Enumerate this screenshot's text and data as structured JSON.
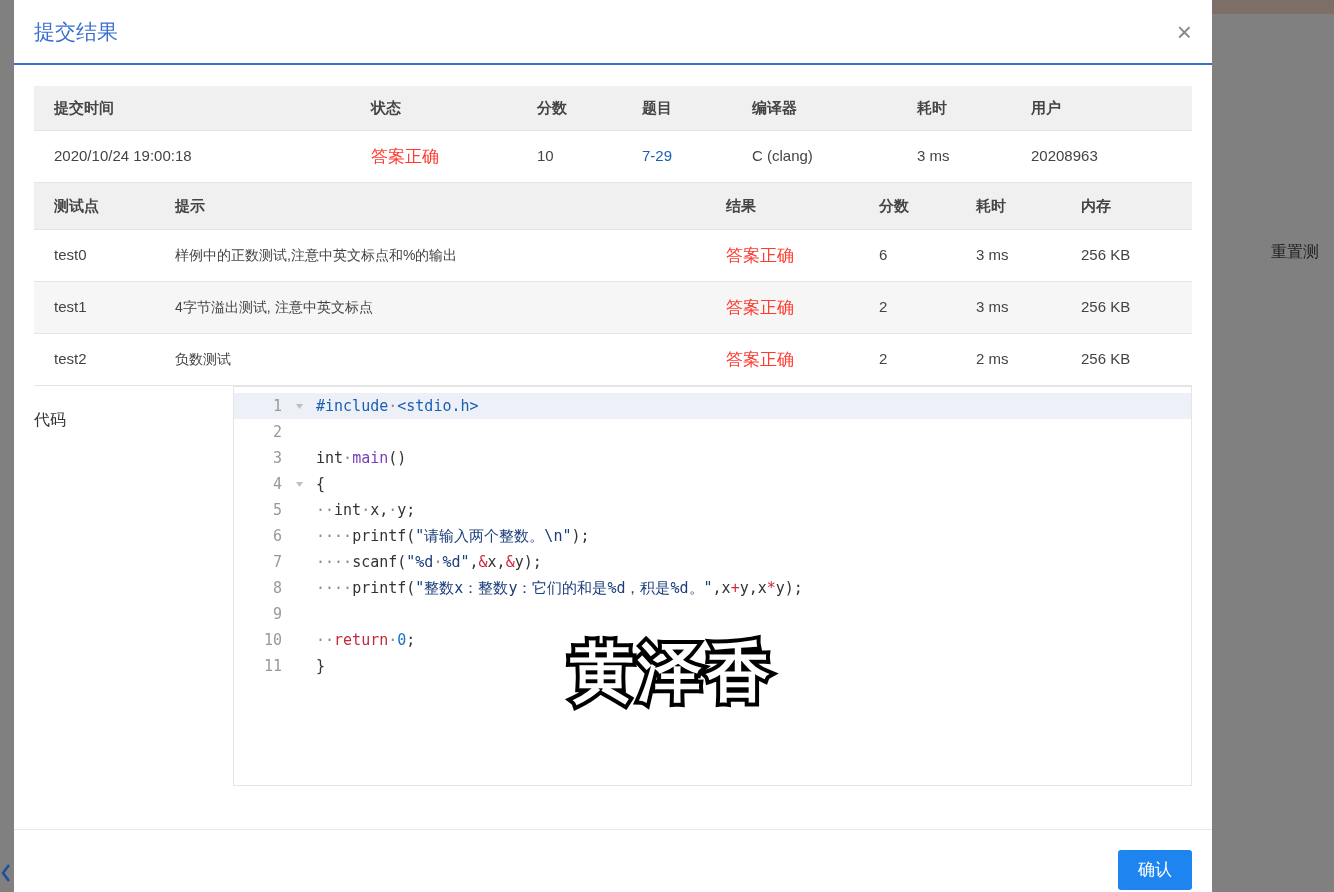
{
  "background": {
    "right_text": "重置测"
  },
  "dialog": {
    "title": "提交结果",
    "close": "×"
  },
  "summary": {
    "columns": [
      "提交时间",
      "状态",
      "分数",
      "题目",
      "编译器",
      "耗时",
      "用户"
    ],
    "row": {
      "time": "2020/10/24 19:00:18",
      "status": "答案正确",
      "score": "10",
      "problem": "7-29",
      "compiler": "C (clang)",
      "duration": "3 ms",
      "user": "20208963"
    }
  },
  "tests": {
    "columns": [
      "测试点",
      "提示",
      "结果",
      "分数",
      "耗时",
      "内存"
    ],
    "rows": [
      {
        "name": "test0",
        "hint": "样例中的正数测试,注意中英文标点和%的输出",
        "result": "答案正确",
        "score": "6",
        "duration": "3 ms",
        "memory": "256 KB"
      },
      {
        "name": "test1",
        "hint": "4字节溢出测试, 注意中英文标点",
        "result": "答案正确",
        "score": "2",
        "duration": "3 ms",
        "memory": "256 KB"
      },
      {
        "name": "test2",
        "hint": "负数测试",
        "result": "答案正确",
        "score": "2",
        "duration": "2 ms",
        "memory": "256 KB"
      }
    ]
  },
  "code": {
    "label": "代码",
    "lines": [
      {
        "number": "1",
        "fold": true,
        "active": true,
        "tokens": [
          {
            "kind": "pre",
            "text": "#include"
          },
          {
            "kind": "ws",
            "text": "·"
          },
          {
            "kind": "pre",
            "text": "<stdio.h>"
          }
        ]
      },
      {
        "number": "2",
        "fold": false,
        "active": false
      },
      {
        "number": "3",
        "fold": false,
        "active": false,
        "tokens": [
          {
            "kind": "plain",
            "text": "int"
          },
          {
            "kind": "ws",
            "text": "·"
          },
          {
            "kind": "func",
            "text": "main"
          },
          {
            "kind": "plain",
            "text": "()"
          }
        ]
      },
      {
        "number": "4",
        "fold": true,
        "active": false,
        "tokens": [
          {
            "kind": "plain",
            "text": "{"
          }
        ]
      },
      {
        "number": "5",
        "fold": false,
        "active": false,
        "tokens": [
          {
            "kind": "ws",
            "text": "··"
          },
          {
            "kind": "plain",
            "text": "int"
          },
          {
            "kind": "ws",
            "text": "·"
          },
          {
            "kind": "plain",
            "text": "x,"
          },
          {
            "kind": "ws",
            "text": "·"
          },
          {
            "kind": "plain",
            "text": "y;"
          }
        ]
      },
      {
        "number": "6",
        "fold": false,
        "active": false,
        "tokens": [
          {
            "kind": "ws",
            "text": "····"
          },
          {
            "kind": "plain",
            "text": "printf("
          },
          {
            "kind": "string",
            "text": "\"请输入两个整数。\\n\""
          },
          {
            "kind": "plain",
            "text": ");"
          }
        ]
      },
      {
        "number": "7",
        "fold": false,
        "active": false,
        "tokens": [
          {
            "kind": "ws",
            "text": "····"
          },
          {
            "kind": "plain",
            "text": "scanf("
          },
          {
            "kind": "string",
            "text": "\"%d"
          },
          {
            "kind": "ws",
            "text": "·"
          },
          {
            "kind": "string",
            "text": "%d\""
          },
          {
            "kind": "plain",
            "text": ","
          },
          {
            "kind": "op",
            "text": "&"
          },
          {
            "kind": "plain",
            "text": "x,"
          },
          {
            "kind": "op",
            "text": "&"
          },
          {
            "kind": "plain",
            "text": "y);"
          }
        ]
      },
      {
        "number": "8",
        "fold": false,
        "active": false,
        "tokens": [
          {
            "kind": "ws",
            "text": "····"
          },
          {
            "kind": "plain",
            "text": "printf("
          },
          {
            "kind": "string",
            "text": "\"整数x：整数y：它们的和是%d，积是%d。\""
          },
          {
            "kind": "plain",
            "text": ",x"
          },
          {
            "kind": "op",
            "text": "+"
          },
          {
            "kind": "plain",
            "text": "y,x"
          },
          {
            "kind": "op",
            "text": "*"
          },
          {
            "kind": "plain",
            "text": "y);"
          }
        ]
      },
      {
        "number": "9",
        "fold": false,
        "active": false
      },
      {
        "number": "10",
        "fold": false,
        "active": false,
        "tokens": [
          {
            "kind": "ws",
            "text": "··"
          },
          {
            "kind": "keyword",
            "text": "return"
          },
          {
            "kind": "ws",
            "text": "·"
          },
          {
            "kind": "number",
            "text": "0"
          },
          {
            "kind": "plain",
            "text": ";"
          }
        ]
      },
      {
        "number": "11",
        "fold": false,
        "active": false,
        "tokens": [
          {
            "kind": "plain",
            "text": "}"
          }
        ]
      }
    ]
  },
  "overlay_caption": "黄泽香",
  "footer": {
    "confirm": "确认"
  }
}
